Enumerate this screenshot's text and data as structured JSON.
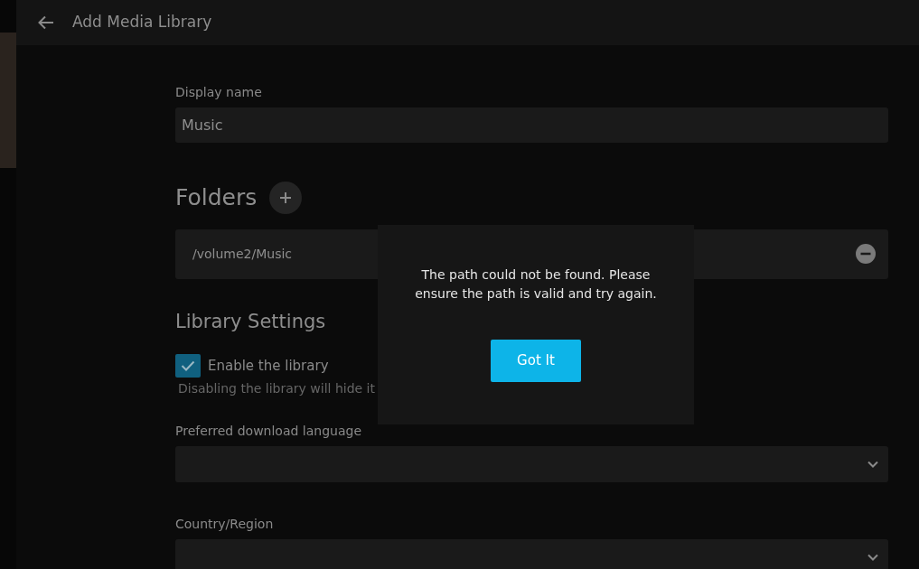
{
  "header": {
    "title": "Add Media Library"
  },
  "display_name": {
    "label": "Display name",
    "value": "Music"
  },
  "folders": {
    "heading": "Folders",
    "items": [
      {
        "path": "/volume2/Music"
      }
    ]
  },
  "library_settings": {
    "heading": "Library Settings",
    "enable": {
      "label": "Enable the library",
      "checked": true,
      "hint": "Disabling the library will hide it"
    }
  },
  "selects": [
    {
      "label": "Preferred download language"
    },
    {
      "label": "Country/Region"
    }
  ],
  "dialog": {
    "message": "The path could not be found. Please ensure the path is valid and try again.",
    "button": "Got It"
  }
}
